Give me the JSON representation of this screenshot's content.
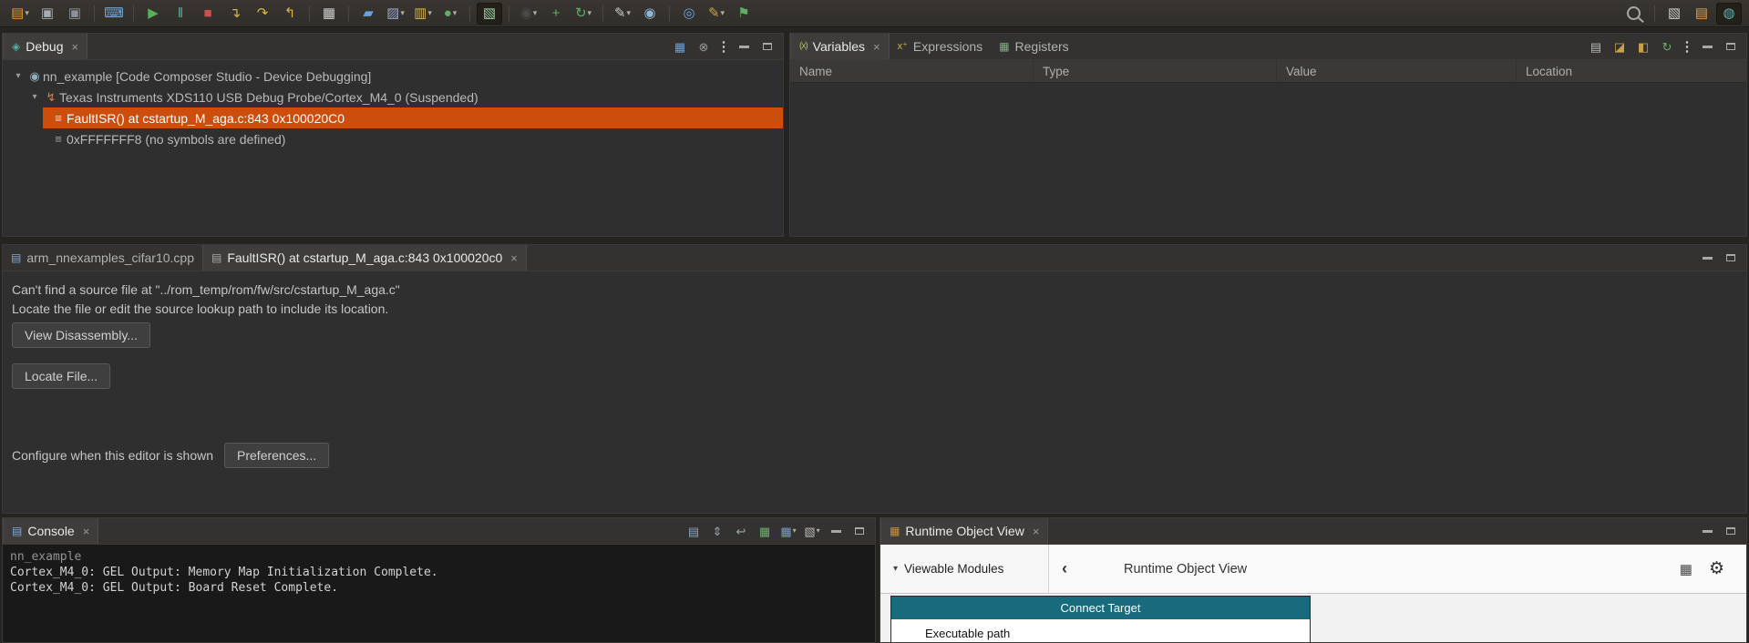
{
  "ui": {
    "close_glyph": "×",
    "chevron_down": "▾",
    "view_menu": "⋮",
    "caret": "▾",
    "back": "‹"
  },
  "toolbar": {
    "left_icons": [
      {
        "name": "new-file-icon",
        "glyph": "▤",
        "color": "#dd9a3c",
        "dropdown": true
      },
      {
        "name": "save-icon",
        "glyph": "▣",
        "color": "#a7acb2"
      },
      {
        "name": "save-all-icon",
        "glyph": "▣",
        "color": "#8e9399"
      },
      {
        "name": "terminal-icon",
        "glyph": "⌨",
        "color": "#74a9d8",
        "sep_before": true
      },
      {
        "name": "resume-icon",
        "glyph": "▶",
        "color": "#55b155",
        "sep_before": true
      },
      {
        "name": "suspend-icon",
        "glyph": "‖",
        "color": "#5fb3a8"
      },
      {
        "name": "terminate-icon",
        "glyph": "■",
        "color": "#cf4f4f"
      },
      {
        "name": "step-into-icon",
        "glyph": "↴",
        "color": "#d8b44a"
      },
      {
        "name": "step-over-icon",
        "glyph": "↷",
        "color": "#d8b44a"
      },
      {
        "name": "step-return-icon",
        "glyph": "↰",
        "color": "#d8b44a"
      },
      {
        "name": "view-grid-icon",
        "glyph": "▦",
        "color": "#cfcfcf",
        "sep_before": true
      },
      {
        "name": "target-config-icon",
        "glyph": "▰",
        "color": "#6aa2d8",
        "sep_before": true
      },
      {
        "name": "flash-icon",
        "glyph": "▨",
        "color": "#9aa3cc",
        "dropdown": true
      },
      {
        "name": "memory-browser-icon",
        "glyph": "▥",
        "color": "#d2b44a",
        "dropdown": true
      },
      {
        "name": "profile-icon",
        "glyph": "●",
        "color": "#5fae68",
        "dropdown": true
      },
      {
        "name": "connect-target-icon",
        "glyph": "▧",
        "color": "#9fd1a4",
        "pressed": true,
        "sep_before": true
      },
      {
        "name": "probe-icon",
        "glyph": "◉",
        "color": "#4a4a48",
        "dropdown": true,
        "sep_before": true
      },
      {
        "name": "add-watch-icon",
        "glyph": "+",
        "color": "#5fae68"
      },
      {
        "name": "refresh-icon",
        "glyph": "↻",
        "color": "#5fae68",
        "dropdown": true
      },
      {
        "name": "trace-icon",
        "glyph": "✎",
        "color": "#c9c9c9",
        "dropdown": true,
        "sep_before": true
      },
      {
        "name": "camera-icon",
        "glyph": "◉",
        "color": "#8fb7d8"
      },
      {
        "name": "core-info-icon",
        "glyph": "◎",
        "color": "#6aa2d8",
        "sep_before": true
      },
      {
        "name": "annotate-icon",
        "glyph": "✎",
        "color": "#c9a14a",
        "dropdown": true
      },
      {
        "name": "flag-icon",
        "glyph": "⚑",
        "color": "#5fae68"
      }
    ],
    "right_icons": [
      {
        "name": "search-icon",
        "glyph": "",
        "color": "#a8a8a8"
      },
      {
        "name": "open-perspective-icon",
        "glyph": "▧",
        "color": "#c9c9c9",
        "sep_before": true
      },
      {
        "name": "edit-perspective-icon",
        "glyph": "▤",
        "color": "#d8a05a"
      },
      {
        "name": "debug-perspective-icon",
        "glyph": "◍",
        "color": "#5fb3a8",
        "pressed": true
      }
    ]
  },
  "debug_panel": {
    "tab_label": "Debug",
    "tab_icon": "◈",
    "toolbar_icons": [
      {
        "name": "multicore-view-icon",
        "glyph": "▦",
        "color": "#6f9fd8"
      },
      {
        "name": "remove-terminated-icon",
        "glyph": "⊗",
        "color": "#9a9a9a"
      }
    ],
    "tree": [
      {
        "icon_glyph": "◉",
        "label": "nn_example [Code Composer Studio - Device Debugging]"
      },
      {
        "icon_glyph": "↯",
        "label": "Texas Instruments XDS110 USB Debug Probe/Cortex_M4_0 (Suspended)"
      },
      {
        "icon_glyph": "≡",
        "label": "FaultISR() at cstartup_M_aga.c:843 0x100020C0"
      },
      {
        "icon_glyph": "≡",
        "label": "0xFFFFFFF8 (no symbols are defined)"
      }
    ]
  },
  "variables_panel": {
    "tabs": [
      {
        "label": "Variables",
        "icon": "(x)"
      },
      {
        "label": "Expressions",
        "icon": "x⁺"
      },
      {
        "label": "Registers",
        "icon": "▦"
      }
    ],
    "toolbar_icons": [
      {
        "name": "show-columns-icon",
        "glyph": "▤",
        "color": "#b8b8b8"
      },
      {
        "name": "import-icon",
        "glyph": "◪",
        "color": "#c9a14a"
      },
      {
        "name": "export-icon",
        "glyph": "◧",
        "color": "#c9a14a"
      },
      {
        "name": "refresh-icon",
        "glyph": "↻",
        "color": "#6cae6c"
      }
    ],
    "columns": [
      "Name",
      "Type",
      "Value",
      "Location"
    ]
  },
  "editor": {
    "tabs": [
      {
        "label": "arm_nnexamples_cifar10.cpp",
        "icon": "▤"
      },
      {
        "label": "FaultISR() at cstartup_M_aga.c:843 0x100020c0",
        "icon": "▤"
      }
    ],
    "message_line1": "Can't find a source file at \"../rom_temp/rom/fw/src/cstartup_M_aga.c\"",
    "message_line2": "Locate the file or edit the source lookup path to include its location.",
    "view_disassembly_button": "View Disassembly...",
    "locate_file_button": "Locate File...",
    "configure_label": "Configure when this editor is shown",
    "preferences_button": "Preferences..."
  },
  "console_panel": {
    "tab_label": "Console",
    "tab_icon": "▤",
    "toolbar_icons": [
      {
        "name": "pin-console-icon",
        "glyph": "▤",
        "color": "#86a7c8"
      },
      {
        "name": "scroll-lock-icon",
        "glyph": "⇕",
        "color": "#9aa3ac"
      },
      {
        "name": "word-wrap-icon",
        "glyph": "↩",
        "color": "#9aac9a"
      },
      {
        "name": "clear-console-icon",
        "glyph": "▦",
        "color": "#6cae6c"
      },
      {
        "name": "display-console-icon",
        "glyph": "▦",
        "color": "#6f9fd8",
        "dropdown": true
      },
      {
        "name": "open-console-icon",
        "glyph": "▧",
        "color": "#b8b8b8",
        "dropdown": true
      }
    ],
    "lines": [
      "nn_example",
      "Cortex_M4_0: GEL Output: Memory Map Initialization Complete.",
      "Cortex_M4_0: GEL Output: Board Reset Complete."
    ]
  },
  "rov_panel": {
    "tab_label": "Runtime Object View",
    "tab_icon": "▦",
    "viewable_modules_label": "Viewable Modules",
    "title": "Runtime Object View",
    "grid_icon": "▦",
    "gear_icon": "⚙",
    "connect_target_button": "Connect Target",
    "first_row": "Executable path"
  }
}
